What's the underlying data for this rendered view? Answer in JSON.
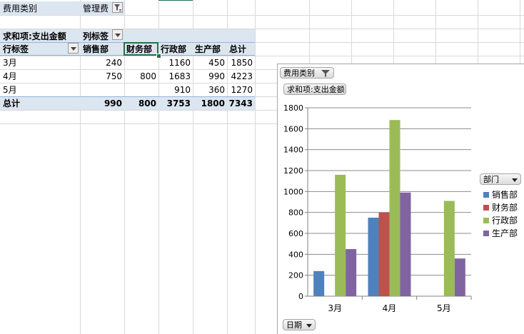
{
  "pivot": {
    "filter_label": "费用类别",
    "filter_value": "管理费",
    "values_label": "求和项:支出金额",
    "col_label": "列标签",
    "row_label": "行标签",
    "columns": [
      "销售部",
      "财务部",
      "行政部",
      "生产部",
      "总计"
    ],
    "rows": [
      {
        "label": "3月",
        "values": [
          "240",
          "",
          "1160",
          "450",
          "1850"
        ]
      },
      {
        "label": "4月",
        "values": [
          "750",
          "800",
          "1683",
          "990",
          "4223"
        ]
      },
      {
        "label": "5月",
        "values": [
          "",
          "",
          "910",
          "360",
          "1270"
        ]
      }
    ],
    "total": {
      "label": "总计",
      "values": [
        "990",
        "800",
        "3753",
        "1800",
        "7343"
      ]
    }
  },
  "chart": {
    "filter_field": "费用类别",
    "values_field": "求和项:支出金额",
    "legend_field": "部门",
    "axis_field": "日期"
  },
  "chart_data": {
    "type": "bar",
    "categories": [
      "3月",
      "4月",
      "5月"
    ],
    "series": [
      {
        "name": "销售部",
        "color": "#4f81bd",
        "values": [
          240,
          750,
          0
        ]
      },
      {
        "name": "财务部",
        "color": "#c0504d",
        "values": [
          0,
          800,
          0
        ]
      },
      {
        "name": "行政部",
        "color": "#9bbb59",
        "values": [
          1160,
          1683,
          910
        ]
      },
      {
        "name": "生产部",
        "color": "#8064a2",
        "values": [
          450,
          990,
          360
        ]
      }
    ],
    "ylim": [
      0,
      1800
    ],
    "yticks": [
      "0",
      "200",
      "400",
      "600",
      "800",
      "1000",
      "1200",
      "1400",
      "1600",
      "1800"
    ],
    "grid": true,
    "legend_position": "right"
  }
}
